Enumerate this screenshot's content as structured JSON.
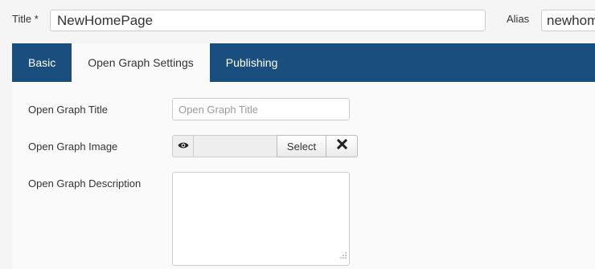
{
  "header": {
    "title_label": "Title *",
    "title_value": "NewHomePage",
    "alias_label": "Alias",
    "alias_value": "newhomepage"
  },
  "tabs": [
    {
      "label": "Basic",
      "active": false
    },
    {
      "label": "Open Graph Settings",
      "active": true
    },
    {
      "label": "Publishing",
      "active": false
    }
  ],
  "form": {
    "og_title_label": "Open Graph Title",
    "og_title_placeholder": "Open Graph Title",
    "og_image_label": "Open Graph Image",
    "select_label": "Select",
    "og_description_label": "Open Graph Description"
  },
  "icons": {
    "preview": "eye-icon",
    "clear": "close-icon",
    "resize": "resize-grip-icon"
  },
  "colors": {
    "tab_bar": "#1a4e7e",
    "active_tab": "#fafafa"
  }
}
